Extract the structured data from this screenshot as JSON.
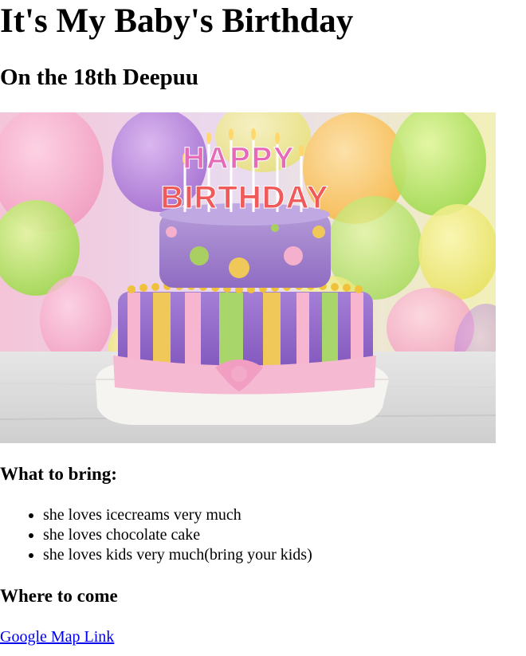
{
  "page": {
    "title": "It's My Baby's Birthday",
    "subtitle": "On the 18th Deepuu"
  },
  "image": {
    "icon": "birthday-cake-image",
    "topper_line1": "HAPPY",
    "topper_line2": "BIRTHDAY"
  },
  "bring": {
    "heading": "What to bring:",
    "items": [
      "she loves icecreams very much",
      "she loves chocolate cake",
      "she loves kids very much(bring your kids)"
    ]
  },
  "where": {
    "heading": "Where to come",
    "link_label": "Google Map Link"
  },
  "colors": {
    "link": "#0000ee",
    "text": "#000000"
  }
}
